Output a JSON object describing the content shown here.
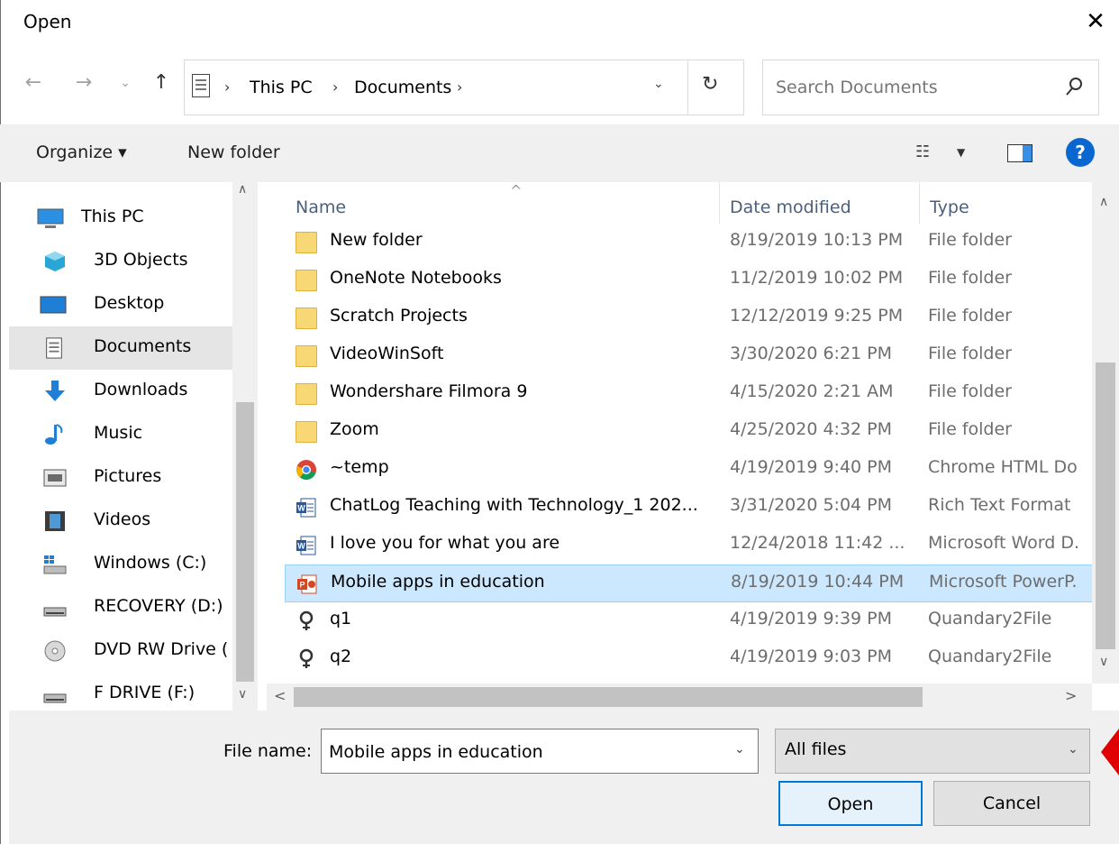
{
  "window": {
    "title": "Open",
    "close_glyph": "✕"
  },
  "nav": {
    "back_glyph": "←",
    "forward_glyph": "→",
    "recent_glyph": "⌄",
    "up_glyph": "↑",
    "breadcrumb": [
      "This PC",
      "Documents"
    ],
    "breadcrumb_sep": "›",
    "refresh_glyph": "↻",
    "dropdown_glyph": "⌄"
  },
  "search": {
    "placeholder": "Search Documents"
  },
  "toolbar": {
    "organize_label": "Organize ▾",
    "new_folder_label": "New folder",
    "help_label": "?"
  },
  "sidebar": {
    "items": [
      {
        "label": "This PC",
        "icon": "computer-icon"
      },
      {
        "label": "3D Objects",
        "icon": "cube-icon"
      },
      {
        "label": "Desktop",
        "icon": "desktop-icon"
      },
      {
        "label": "Documents",
        "icon": "documents-icon",
        "selected": true
      },
      {
        "label": "Downloads",
        "icon": "download-arrow-icon"
      },
      {
        "label": "Music",
        "icon": "music-note-icon"
      },
      {
        "label": "Pictures",
        "icon": "pictures-icon"
      },
      {
        "label": "Videos",
        "icon": "film-icon"
      },
      {
        "label": "Windows (C:)",
        "icon": "windows-drive-icon"
      },
      {
        "label": "RECOVERY (D:)",
        "icon": "drive-icon"
      },
      {
        "label": "DVD RW Drive (",
        "icon": "dvd-icon"
      },
      {
        "label": "F DRIVE (F:)",
        "icon": "drive-icon"
      }
    ],
    "scroll_up": "∧",
    "scroll_down": "∨"
  },
  "file_list": {
    "columns": [
      "Name",
      "Date modified",
      "Type"
    ],
    "sort_glyph": "^",
    "rows": [
      {
        "name": "New folder",
        "date": "8/19/2019 10:13 PM",
        "type": "File folder",
        "icon": "folder-icon"
      },
      {
        "name": "OneNote Notebooks",
        "date": "11/2/2019 10:02 PM",
        "type": "File folder",
        "icon": "folder-icon"
      },
      {
        "name": "Scratch Projects",
        "date": "12/12/2019 9:25 PM",
        "type": "File folder",
        "icon": "folder-icon"
      },
      {
        "name": "VideoWinSoft",
        "date": "3/30/2020 6:21 PM",
        "type": "File folder",
        "icon": "folder-icon"
      },
      {
        "name": "Wondershare Filmora 9",
        "date": "4/15/2020 2:21 AM",
        "type": "File folder",
        "icon": "folder-icon"
      },
      {
        "name": "Zoom",
        "date": "4/25/2020 4:32 PM",
        "type": "File folder",
        "icon": "folder-icon"
      },
      {
        "name": "~temp",
        "date": "4/19/2019 9:40 PM",
        "type": "Chrome HTML Do",
        "icon": "chrome-icon"
      },
      {
        "name": "ChatLog Teaching with Technology_1 202...",
        "date": "3/31/2020 5:04 PM",
        "type": "Rich Text Format",
        "icon": "word-doc-icon"
      },
      {
        "name": "I love you for what you are",
        "date": "12/24/2018 11:42 ...",
        "type": "Microsoft Word D.",
        "icon": "word-doc-icon"
      },
      {
        "name": "Mobile apps in education",
        "date": "8/19/2019 10:44 PM",
        "type": "Microsoft PowerP.",
        "icon": "powerpoint-icon",
        "selected": true
      },
      {
        "name": "q1",
        "date": "4/19/2019 9:39 PM",
        "type": "Quandary2File",
        "icon": "quandary-icon"
      },
      {
        "name": "q2",
        "date": "4/19/2019 9:03 PM",
        "type": "Quandary2File",
        "icon": "quandary-icon"
      }
    ],
    "vscroll_up": "∧",
    "vscroll_down": "∨",
    "hscroll_left": "<",
    "hscroll_right": ">"
  },
  "footer": {
    "file_name_label": "File name:",
    "file_name_value": "Mobile apps in education",
    "file_name_dropdown": "⌄",
    "file_type_value": "All files",
    "file_type_dropdown": "⌄",
    "open_label": "Open",
    "cancel_label": "Cancel"
  },
  "colors": {
    "selection": "#cce8ff",
    "accent": "#0078d7",
    "pointer": "#e00000",
    "folder": "#f8d775"
  }
}
